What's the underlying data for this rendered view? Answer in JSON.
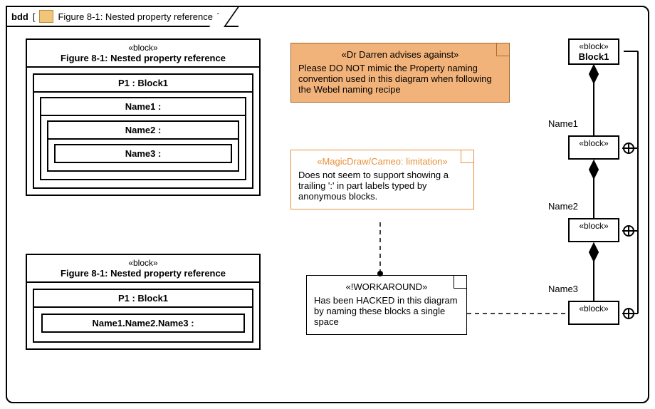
{
  "frame": {
    "kw": "bdd",
    "title": "Figure 8-1: Nested property reference"
  },
  "topBlock": {
    "stereo": "«block»",
    "name": "Figure 8-1: Nested property reference",
    "p1": "P1 : Block1",
    "n1": "Name1 :",
    "n2": "Name2 :",
    "n3": "Name3 :"
  },
  "bottomBlock": {
    "stereo": "«block»",
    "name": "Figure 8-1: Nested property reference",
    "p1": "P1 : Block1",
    "path": "Name1.Name2.Name3 :"
  },
  "note1": {
    "stereo": "«Dr Darren advises against»",
    "body": "Please DO NOT mimic the Property naming convention used in this diagram when following the Webel naming recipe"
  },
  "note2": {
    "stereo": "«MagicDraw/Cameo: limitation»",
    "body": "Does not seem to support showing a trailing ':' in part labels typed by anonymous blocks."
  },
  "note3": {
    "stereo": "«!WORKAROUND»",
    "body": "Has been HACKED in this diagram by naming these blocks a single space"
  },
  "chain": {
    "block1": {
      "stereo": "«block»",
      "name": "Block1"
    },
    "anon": {
      "stereo": "«block»"
    },
    "labels": {
      "n1": "Name1",
      "n2": "Name2",
      "n3": "Name3"
    }
  }
}
